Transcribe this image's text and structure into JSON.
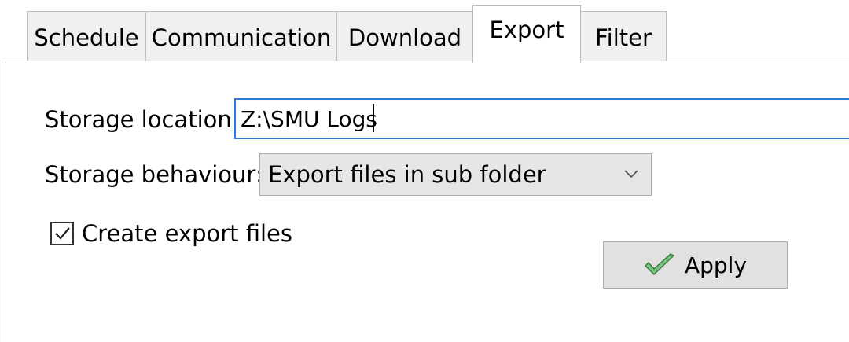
{
  "tabs": [
    {
      "label": "Schedule"
    },
    {
      "label": "Communication"
    },
    {
      "label": "Download"
    },
    {
      "label": "Export",
      "active": true
    },
    {
      "label": "Filter"
    }
  ],
  "export": {
    "storage_location_label": "Storage location:",
    "storage_location_value": "Z:\\SMU Logs",
    "storage_behaviour_label": "Storage behaviour:",
    "storage_behaviour_selected": "Export files in sub folder",
    "create_export_files_label": "Create export files",
    "create_export_files_checked": true,
    "apply_label": "Apply"
  },
  "icons": {
    "dropdown": "chevron-down-icon",
    "checkbox_mark": "checkmark-icon",
    "apply": "green-checkmark-icon"
  },
  "colors": {
    "focus_border": "#2e7ad4",
    "apply_check": "#4caf50"
  }
}
